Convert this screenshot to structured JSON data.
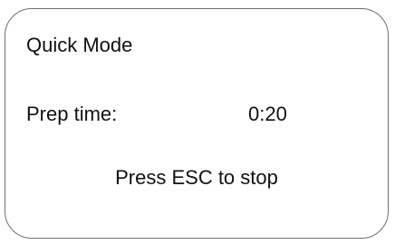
{
  "panel": {
    "title": "Quick Mode",
    "prep_time": {
      "label": "Prep time:",
      "value": "0:20"
    },
    "hint": "Press ESC to stop"
  }
}
